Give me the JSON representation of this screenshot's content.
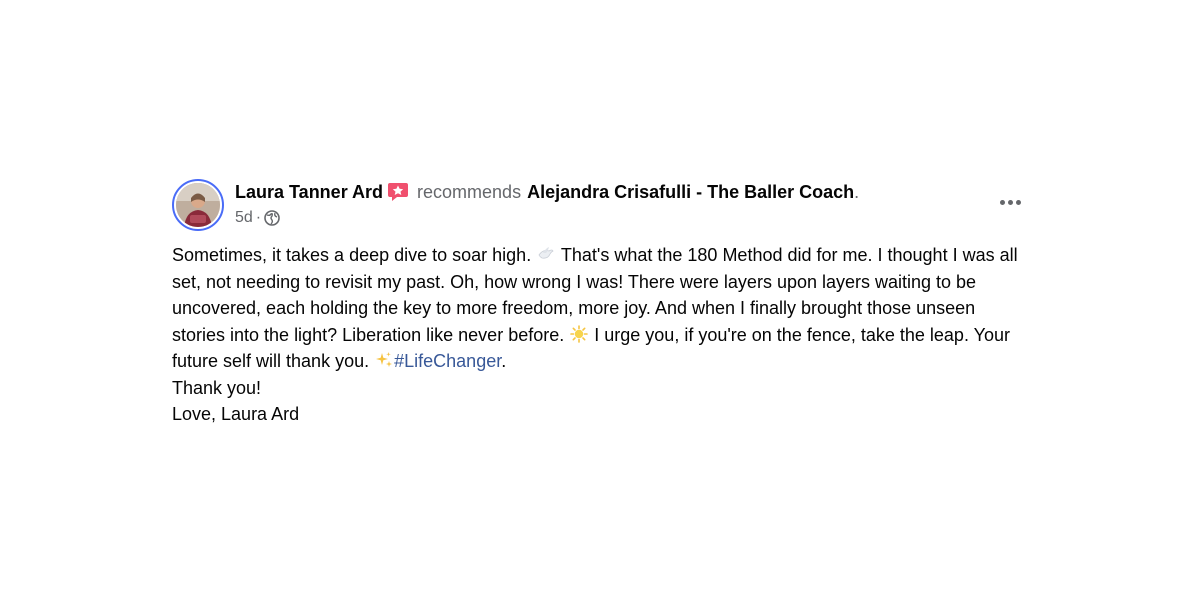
{
  "post": {
    "author": "Laura Tanner Ard",
    "action": "recommends",
    "page_name": "Alejandra Crisafulli - The Baller Coach",
    "page_name_suffix": ".",
    "time": "5d",
    "separator": "·",
    "privacy_icon": "globe-icon",
    "badge_icon": "recommend-star-icon",
    "more_icon": "more-options-icon",
    "body": {
      "seg1": "Sometimes, it takes a deep dive to soar high.",
      "emoji1": "dove-icon",
      "seg2": "That's what the 180 Method did for me. I thought I was all set, not needing to revisit my past. Oh, how wrong I was! There were layers upon layers waiting to be uncovered, each holding the key to more freedom, more joy. And when I finally brought those unseen stories into the light? Liberation like never before.",
      "emoji2": "sun-icon",
      "seg3": "I urge you, if you're on the fence, take the leap. Your future self will thank you.",
      "emoji3": "sparkles-icon",
      "hashtag": "#LifeChanger",
      "seg4": ".",
      "line2": "Thank you!",
      "line3": "Love, Laura Ard"
    }
  },
  "colors": {
    "text": "#050505",
    "secondary": "#65676b",
    "link": "#385898",
    "avatar_ring": "#4a6cf7",
    "badge": "#f0506e"
  }
}
